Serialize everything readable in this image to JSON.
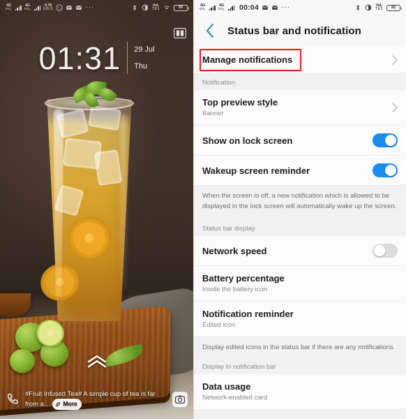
{
  "lock_screen": {
    "status_bar": {
      "signal_1": {
        "network": "4G",
        "label": "vo₁"
      },
      "signal_2": {
        "network": "4G",
        "label": "vo₂"
      },
      "speed": {
        "value": "6.79",
        "unit": "KB/S"
      },
      "icons": [
        "whatsapp-icon",
        "message-icon",
        "message-icon"
      ],
      "overflow": "···",
      "right_icons": [
        "bluetooth-icon",
        "do-not-disturb-icon",
        "volte-icon",
        "wifi-icon"
      ],
      "battery_percent": "89"
    },
    "magazine_icon": "open-book-icon",
    "clock": {
      "time": "01:31",
      "date": "29 Jul",
      "weekday": "Thu"
    },
    "unlock_hint_icon": "double-chevron-up-icon",
    "caption": {
      "phone_icon": "phone-icon",
      "text": "#Fruit Infused Tea# A simple cup of tea is far from a…",
      "more_label": "More",
      "more_icon": "link-icon",
      "camera_icon": "camera-icon"
    }
  },
  "settings": {
    "status_bar": {
      "signal_1": {
        "network": "4G",
        "label": "vo₁"
      },
      "signal_2": {
        "network": "4G",
        "label": "vo₂"
      },
      "time": "00:04",
      "icons": [
        "message-icon",
        "message-icon"
      ],
      "overflow": "···",
      "right_icons": [
        "bluetooth-icon",
        "do-not-disturb-icon",
        "volte-icon"
      ],
      "battery_percent": "92"
    },
    "header": {
      "back_icon": "chevron-left-icon",
      "title": "Status bar and notification"
    },
    "highlight_color": "#e8191b",
    "accent_color": "#1a8cf0",
    "back_color": "#1d8f7e",
    "items": [
      {
        "name": "manage-notifications",
        "title": "Manage notifications",
        "sub": "",
        "control": "chevron",
        "highlighted": true
      },
      {
        "name": "notification-section",
        "type": "section",
        "title": "Notification"
      },
      {
        "name": "top-preview-style",
        "title": "Top preview style",
        "sub": "Banner",
        "control": "chevron"
      },
      {
        "name": "show-on-lock-screen",
        "title": "Show on lock screen",
        "sub": "",
        "control": "toggle",
        "toggle_state": "on"
      },
      {
        "name": "wakeup-screen-reminder",
        "title": "Wakeup screen reminder",
        "sub": "",
        "control": "toggle",
        "toggle_state": "on"
      },
      {
        "name": "wakeup-description",
        "type": "description",
        "title": "When the screen is off, a new notification which is allowed to be displayed in the lock screen will automatically wake up the screen."
      },
      {
        "name": "status-bar-display-section",
        "type": "section",
        "title": "Status bar display"
      },
      {
        "name": "network-speed",
        "title": "Network speed",
        "sub": "",
        "control": "toggle",
        "toggle_state": "off"
      },
      {
        "name": "battery-percentage",
        "title": "Battery percentage",
        "sub": "Inside the battery icon",
        "control": "none"
      },
      {
        "name": "notification-reminder",
        "title": "Notification reminder",
        "sub": "Edited icon",
        "control": "none"
      },
      {
        "name": "notification-reminder-description",
        "type": "description",
        "title": "Display edited icons in the status bar if there are any notifications."
      },
      {
        "name": "display-in-notification-bar-section",
        "type": "section",
        "title": "Display in notification bar"
      },
      {
        "name": "data-usage",
        "title": "Data usage",
        "sub": "Network-enabled card",
        "control": "none"
      }
    ]
  }
}
